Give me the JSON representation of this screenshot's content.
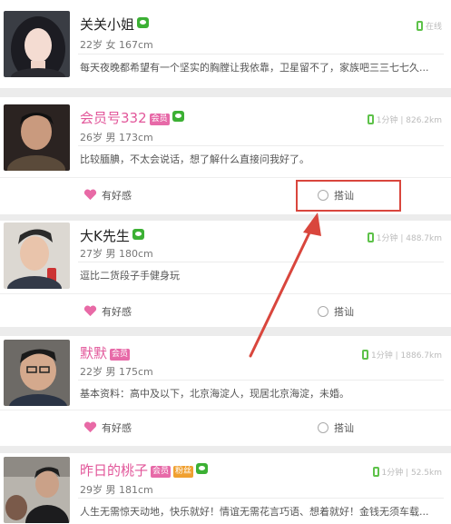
{
  "feed": {
    "items": [
      {
        "name": "关关小姐",
        "member": false,
        "fans": false,
        "age": "22岁",
        "gender": "女",
        "height": "167cm",
        "status": "在线",
        "bio": "每天夜晚都希望有一个坚实的胸膛让我依靠，卫星留不了，家族吧三三七七久...",
        "avatar": "woman-avatar",
        "has_actions": false
      },
      {
        "name": "会员号332",
        "member": true,
        "fans": false,
        "member_label": "会员",
        "age": "26岁",
        "gender": "男",
        "height": "173cm",
        "status": "1分钟 | 826.2km",
        "bio": "比较腼腆，不太会说话，想了解什么直接问我好了。",
        "avatar": "man-avatar",
        "has_actions": true,
        "like_label": "有好感",
        "chat_label": "搭讪"
      },
      {
        "name": "大K先生",
        "member": false,
        "fans": false,
        "age": "27岁",
        "gender": "男",
        "height": "180cm",
        "status": "1分钟 | 488.7km",
        "bio": "逗比二货段子手健身玩",
        "avatar": "man-avatar",
        "has_actions": true,
        "like_label": "有好感",
        "chat_label": "搭讪"
      },
      {
        "name": "默默",
        "member": true,
        "fans": false,
        "member_label": "会员",
        "age": "22岁",
        "gender": "男",
        "height": "175cm",
        "status": "1分钟 | 1886.7km",
        "bio": "基本资料：高中及以下，北京海淀人，现居北京海淀，未婚。",
        "avatar": "man-avatar",
        "has_actions": true,
        "like_label": "有好感",
        "chat_label": "搭讪"
      },
      {
        "name": "昨日的桃子",
        "member": true,
        "fans": true,
        "member_label": "会员",
        "fans_label": "粉丝",
        "age": "29岁",
        "gender": "男",
        "height": "181cm",
        "status": "1分钟 | 52.5km",
        "bio": "人生无需惊天动地，快乐就好！情谊无需花言巧语、想着就好！金钱无须车载...",
        "avatar": "man-avatar",
        "has_actions": false
      }
    ]
  },
  "colors": {
    "member_name": "#e2579a",
    "heart": "#e86aa6",
    "wechat": "#3cb034",
    "online_phone": "#5ec24a",
    "highlight": "#d9463d"
  }
}
